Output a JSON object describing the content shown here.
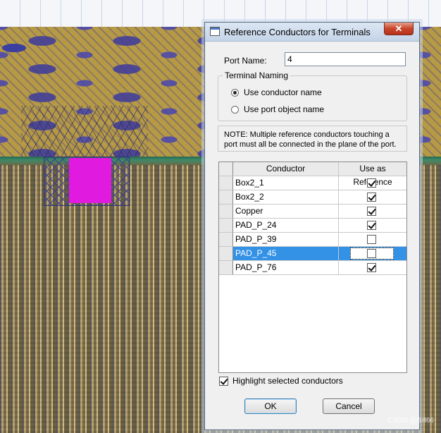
{
  "dialog": {
    "title": "Reference Conductors for Terminals",
    "close_label": "✕",
    "port_name_label": "Port Name:",
    "port_name_value": "4",
    "terminal_naming": {
      "legend": "Terminal Naming",
      "options": [
        {
          "label": "Use conductor name",
          "selected": true
        },
        {
          "label": "Use port object name",
          "selected": false
        }
      ]
    },
    "note": "NOTE: Multiple reference conductors touching a port must all be connected in the plane of the port.",
    "table": {
      "headers": [
        "Conductor",
        "Use as Reference"
      ],
      "rows": [
        {
          "conductor": "Box2_1",
          "use_as_reference": true,
          "selected": false
        },
        {
          "conductor": "Box2_2",
          "use_as_reference": true,
          "selected": false
        },
        {
          "conductor": "Copper",
          "use_as_reference": true,
          "selected": false
        },
        {
          "conductor": "PAD_P_24",
          "use_as_reference": true,
          "selected": false
        },
        {
          "conductor": "PAD_P_39",
          "use_as_reference": false,
          "selected": false
        },
        {
          "conductor": "PAD_P_45",
          "use_as_reference": false,
          "selected": true
        },
        {
          "conductor": "PAD_P_76",
          "use_as_reference": true,
          "selected": false
        }
      ]
    },
    "highlight_label": "Highlight selected conductors",
    "highlight_checked": true,
    "ok_label": "OK",
    "cancel_label": "Cancel"
  },
  "watermark": "CSDN @Bill66",
  "colors": {
    "selection": "#3391e6",
    "port_highlight": "#e01adf",
    "close_button": "#c8452a"
  }
}
